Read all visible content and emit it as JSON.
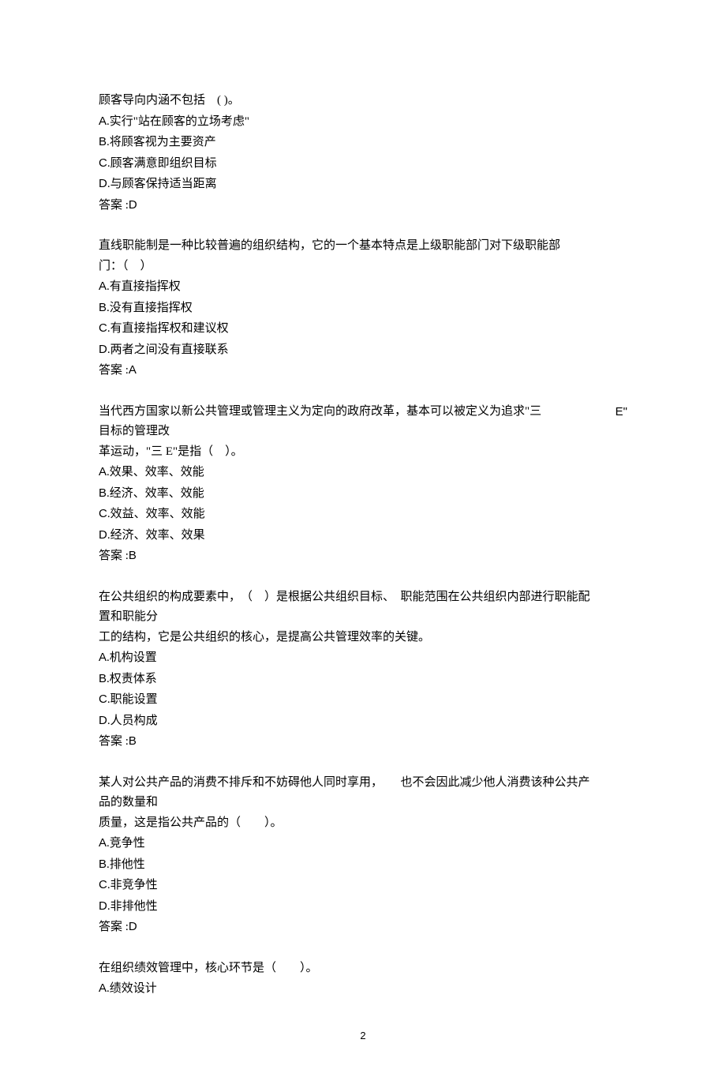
{
  "questions": [
    {
      "stem_lines": [
        "顾客导向内涵不包括　( )。"
      ],
      "options": [
        {
          "letter": "A",
          "text": ".实行\"站在顾客的立场考虑\""
        },
        {
          "letter": "B",
          "text": ".将顾客视为主要资产"
        },
        {
          "letter": "C",
          "text": ".顾客满意即组织目标"
        },
        {
          "letter": "D",
          "text": ".与顾客保持适当距离"
        }
      ],
      "answer_label": "答案 :",
      "answer": "D"
    },
    {
      "stem_lines": [
        "直线职能制是一种比较普遍的组织结构，它的一个基本特点是上级职能部门对下级职能部",
        "门：（　）"
      ],
      "options": [
        {
          "letter": "A",
          "text": ".有直接指挥权"
        },
        {
          "letter": "B",
          "text": ".没有直接指挥权"
        },
        {
          "letter": "C",
          "text": ".有直接指挥权和建议权"
        },
        {
          "letter": "D",
          "text": ".两者之间没有直接联系"
        }
      ],
      "answer_label": "答案 :",
      "answer": "A"
    },
    {
      "stem_first_line_main": "当代西方国家以新公共管理或管理主义为定向的政府改革，基本可以被定义为追求\"三",
      "stem_first_line_trail": "E\"",
      "stem_lines_rest": [
        "目标的管理改",
        "革运动，\"三 E\"是指（　）。"
      ],
      "options": [
        {
          "letter": "A",
          "text": ".效果、效率、效能"
        },
        {
          "letter": "B",
          "text": ".经济、效率、效能"
        },
        {
          "letter": "C",
          "text": ".效益、效率、效能"
        },
        {
          "letter": "D",
          "text": ".经济、效率、效果"
        }
      ],
      "answer_label": "答案 :",
      "answer": "B"
    },
    {
      "stem_lines": [
        "在公共组织的构成要素中，　（　）是根据公共组织目标、　职能范围在公共组织内部进行职能配",
        "置和职能分",
        "工的结构，它是公共组织的核心，是提高公共管理效率的关键。"
      ],
      "options": [
        {
          "letter": "A",
          "text": ".机构设置"
        },
        {
          "letter": "B",
          "text": ".权责体系"
        },
        {
          "letter": "C",
          "text": ".职能设置"
        },
        {
          "letter": "D",
          "text": ".人员构成"
        }
      ],
      "answer_label": "答案 :",
      "answer": "B"
    },
    {
      "stem_lines": [
        "某人对公共产品的消费不排斥和不妨碍他人同时享用，　　也不会因此减少他人消费该种公共产",
        "品的数量和",
        "质量，这是指公共产品的（　　）。"
      ],
      "options": [
        {
          "letter": "A",
          "text": ".竞争性"
        },
        {
          "letter": "B",
          "text": ".排他性"
        },
        {
          "letter": "C",
          "text": ".非竞争性"
        },
        {
          "letter": "D",
          "text": ".非排他性"
        }
      ],
      "answer_label": "答案 :",
      "answer": "D"
    },
    {
      "stem_lines": [
        "在组织绩效管理中，核心环节是（　　）。"
      ],
      "options": [
        {
          "letter": "A",
          "text": ".绩效设计"
        }
      ],
      "answer_label": "",
      "answer": ""
    }
  ],
  "page_number": "2"
}
